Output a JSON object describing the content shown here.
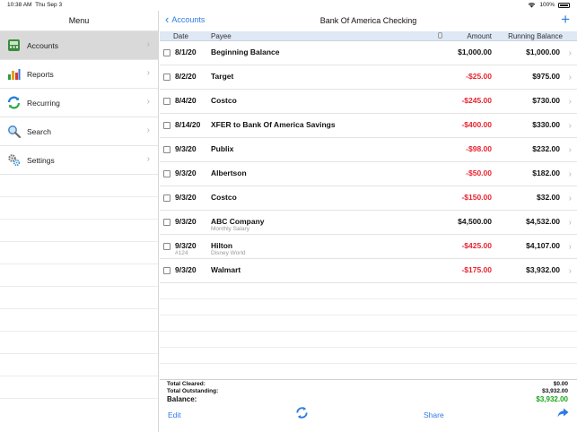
{
  "status_bar": {
    "time": "10:38 AM",
    "date": "Thu Sep 3",
    "battery": "100%"
  },
  "sidebar": {
    "title": "Menu",
    "items": [
      {
        "label": "Accounts",
        "icon": "accounts-icon",
        "selected": true
      },
      {
        "label": "Reports",
        "icon": "reports-chart-icon",
        "selected": false
      },
      {
        "label": "Recurring",
        "icon": "recurring-arrows-icon",
        "selected": false
      },
      {
        "label": "Search",
        "icon": "magnifier-icon",
        "selected": false
      },
      {
        "label": "Settings",
        "icon": "gears-icon",
        "selected": false
      }
    ]
  },
  "header": {
    "back_label": "Accounts",
    "title": "Bank Of America Checking",
    "add_label": "+"
  },
  "columns": {
    "date": "Date",
    "payee": "Payee",
    "amount": "Amount",
    "running": "Running Balance"
  },
  "transactions": [
    {
      "date": "8/1/20",
      "payee": "Beginning Balance",
      "amount": "$1,000.00",
      "negative": false,
      "running": "$1,000.00",
      "memo": "",
      "check": ""
    },
    {
      "date": "8/2/20",
      "payee": "Target",
      "amount": "-$25.00",
      "negative": true,
      "running": "$975.00",
      "memo": "",
      "check": ""
    },
    {
      "date": "8/4/20",
      "payee": "Costco",
      "amount": "-$245.00",
      "negative": true,
      "running": "$730.00",
      "memo": "",
      "check": ""
    },
    {
      "date": "8/14/20",
      "payee": "XFER to Bank Of America Savings",
      "amount": "-$400.00",
      "negative": true,
      "running": "$330.00",
      "memo": "",
      "check": ""
    },
    {
      "date": "9/3/20",
      "payee": "Publix",
      "amount": "-$98.00",
      "negative": true,
      "running": "$232.00",
      "memo": "",
      "check": ""
    },
    {
      "date": "9/3/20",
      "payee": "Albertson",
      "amount": "-$50.00",
      "negative": true,
      "running": "$182.00",
      "memo": "",
      "check": ""
    },
    {
      "date": "9/3/20",
      "payee": "Costco",
      "amount": "-$150.00",
      "negative": true,
      "running": "$32.00",
      "memo": "",
      "check": ""
    },
    {
      "date": "9/3/20",
      "payee": "ABC Company",
      "amount": "$4,500.00",
      "negative": false,
      "running": "$4,532.00",
      "memo": "Monthly Salary",
      "check": ""
    },
    {
      "date": "9/3/20",
      "payee": "Hilton",
      "amount": "-$425.00",
      "negative": true,
      "running": "$4,107.00",
      "memo": "Disney World",
      "check": "#124"
    },
    {
      "date": "9/3/20",
      "payee": "Walmart",
      "amount": "-$175.00",
      "negative": true,
      "running": "$3,932.00",
      "memo": "",
      "check": ""
    }
  ],
  "totals": {
    "cleared_label": "Total Cleared:",
    "cleared_value": "$0.00",
    "outstanding_label": "Total Outstanding:",
    "outstanding_value": "$3,932.00",
    "balance_label": "Balance:",
    "balance_value": "$3,932.00"
  },
  "toolbar": {
    "edit_label": "Edit",
    "share_label": "Share"
  },
  "colors": {
    "accent": "#2f7ae5",
    "negative": "#e8232f",
    "positive_balance": "#1aa51a",
    "header_band": "#dfe8f5"
  }
}
